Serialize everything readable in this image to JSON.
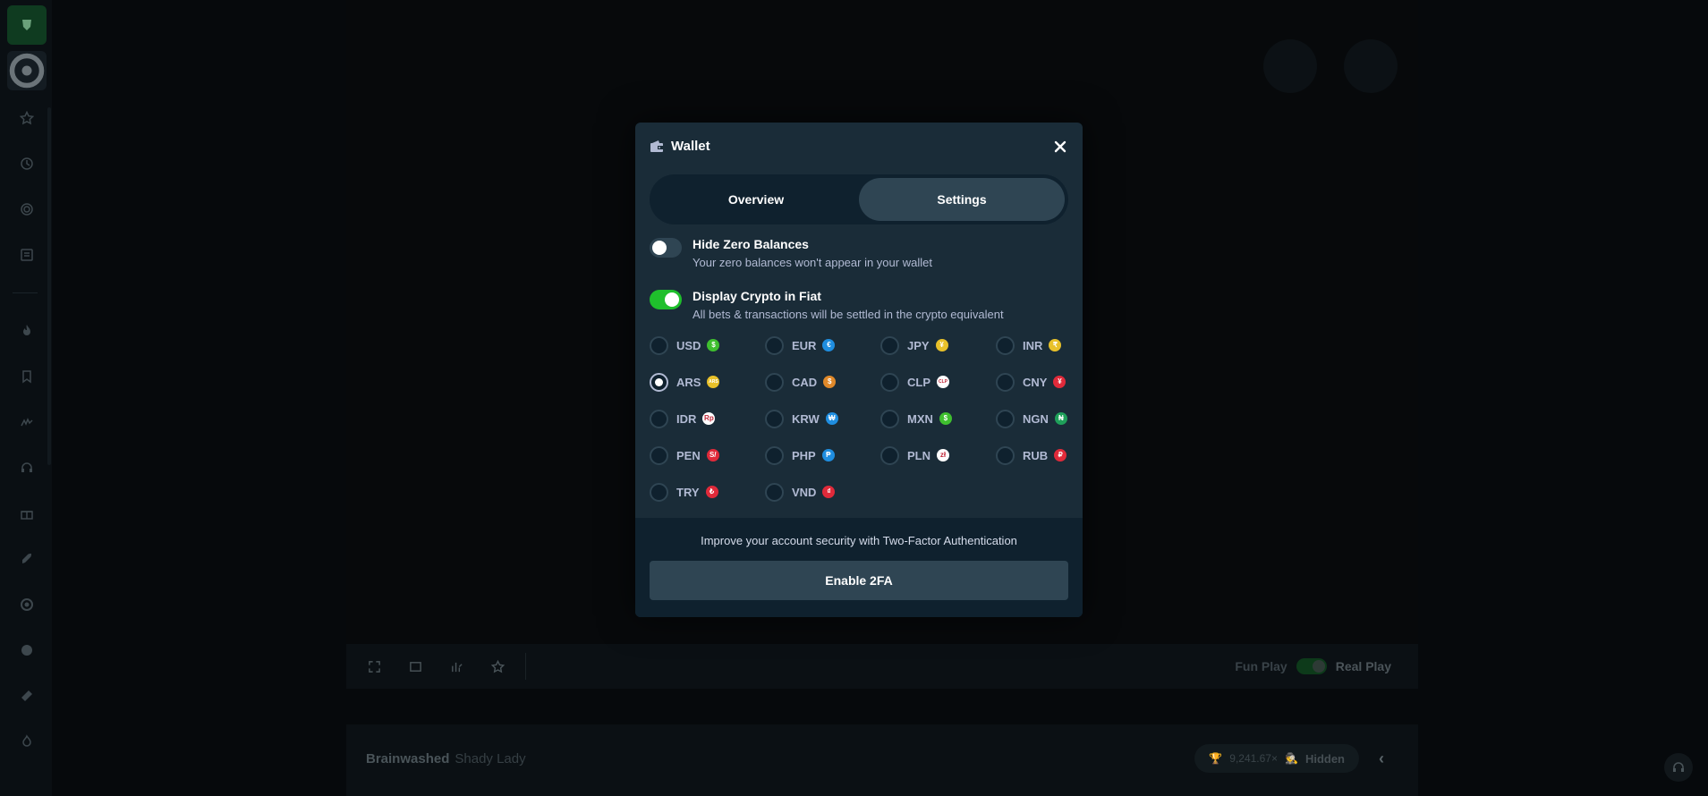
{
  "modal": {
    "title": "Wallet",
    "tabs": [
      {
        "label": "Overview",
        "active": false
      },
      {
        "label": "Settings",
        "active": true
      }
    ],
    "settings": [
      {
        "title": "Hide Zero Balances",
        "description": "Your zero balances won't appear in your wallet",
        "enabled": false
      },
      {
        "title": "Display Crypto in Fiat",
        "description": "All bets & transactions will be settled in the crypto equivalent",
        "enabled": true
      }
    ],
    "currencies": [
      {
        "code": "USD",
        "symbol": "$",
        "color": "#3fbf2f",
        "selected": false
      },
      {
        "code": "EUR",
        "symbol": "€",
        "color": "#1f8ee0",
        "selected": false
      },
      {
        "code": "JPY",
        "symbol": "¥",
        "color": "#e8c12a",
        "selected": false
      },
      {
        "code": "INR",
        "symbol": "₹",
        "color": "#e8c12a",
        "selected": false
      },
      {
        "code": "ARS",
        "symbol": "ARS",
        "color": "#e8c12a",
        "selected": true
      },
      {
        "code": "CAD",
        "symbol": "$",
        "color": "#e0892a",
        "selected": false
      },
      {
        "code": "CLP",
        "symbol": "CLP",
        "color": "#ffffff",
        "selected": false
      },
      {
        "code": "CNY",
        "symbol": "¥",
        "color": "#e02a3a",
        "selected": false
      },
      {
        "code": "IDR",
        "symbol": "Rp",
        "color": "#ffffff",
        "selected": false
      },
      {
        "code": "KRW",
        "symbol": "₩",
        "color": "#1f8ee0",
        "selected": false
      },
      {
        "code": "MXN",
        "symbol": "$",
        "color": "#3fbf2f",
        "selected": false
      },
      {
        "code": "NGN",
        "symbol": "₦",
        "color": "#1fa05a",
        "selected": false
      },
      {
        "code": "PEN",
        "symbol": "S/",
        "color": "#e02a3a",
        "selected": false
      },
      {
        "code": "PHP",
        "symbol": "₱",
        "color": "#1f8ee0",
        "selected": false
      },
      {
        "code": "PLN",
        "symbol": "zł",
        "color": "#ffffff",
        "selected": false
      },
      {
        "code": "RUB",
        "symbol": "₽",
        "color": "#e02a3a",
        "selected": false
      },
      {
        "code": "TRY",
        "symbol": "₺",
        "color": "#e02a3a",
        "selected": false
      },
      {
        "code": "VND",
        "symbol": "₫",
        "color": "#e02a3a",
        "selected": false
      }
    ],
    "footer": {
      "text": "Improve your account security with Two-Factor Authentication",
      "button_label": "Enable 2FA"
    }
  },
  "game_bar": {
    "fun_label": "Fun Play",
    "real_label": "Real Play"
  },
  "game_info": {
    "title": "Brainwashed",
    "provider": "Shady Lady",
    "record_amount": "9,241.67×",
    "hidden_label": "Hidden"
  },
  "colors": {
    "modal_bg": "#1a2c38",
    "footer_bg": "#0f212e",
    "accent_green": "#1fbf2c",
    "tab_active": "#2f4553"
  }
}
